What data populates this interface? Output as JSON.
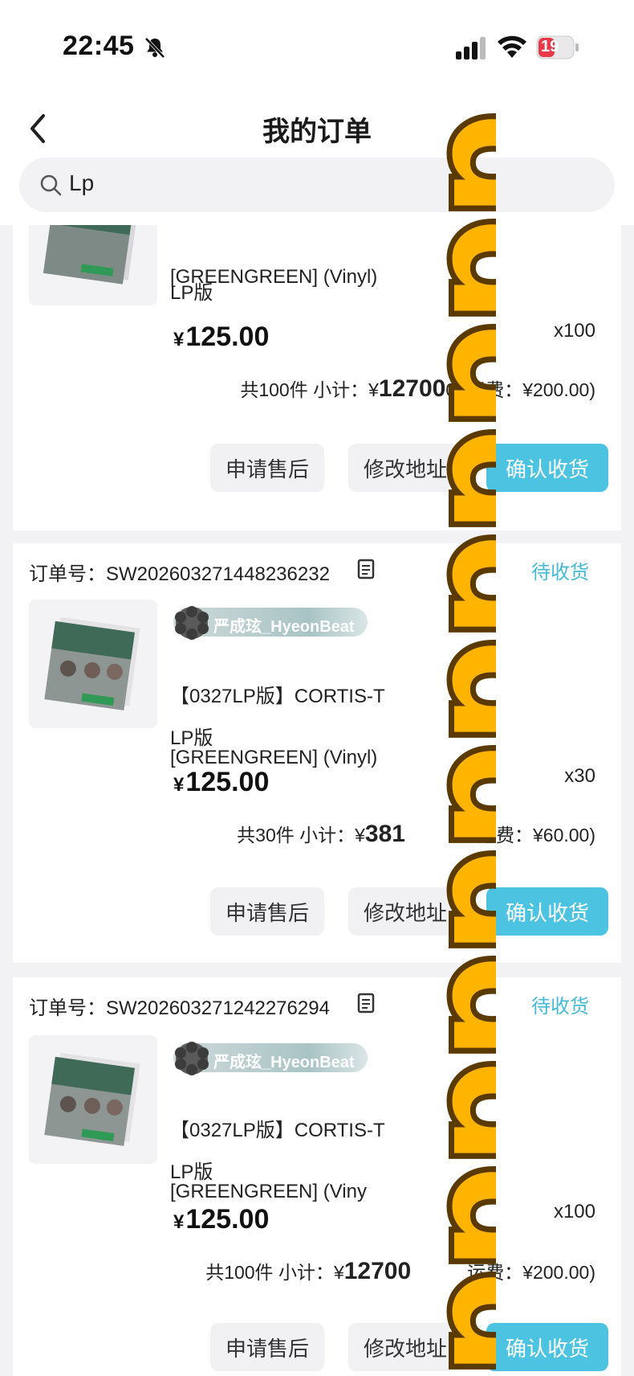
{
  "status_bar": {
    "time": "22:45",
    "battery": "19"
  },
  "header": {
    "title": "我的订单",
    "search_value": "Lp"
  },
  "orders": [
    {
      "order_no": "",
      "status": "",
      "shop": "",
      "title_line2": "[GREENGREEN] (Vinyl)",
      "variant": "LP版",
      "price": "125.00",
      "qty": "x100",
      "count_text": "共100件 小计：¥",
      "subtotal_big": "12700",
      "subtotal_tail": "0 (",
      "shipping": "运费：¥200.00)",
      "btn_after_sale": "申请售后",
      "btn_modify": "修改地址",
      "btn_confirm": "确认收货"
    },
    {
      "order_no": "订单号：SW202603271448236232",
      "status": "待收货",
      "shop": "严成玹_HyeonBeat",
      "title_line1": "【0327LP版】CORTIS-T",
      "title_line2": "[GREENGREEN] (Vinyl)",
      "variant": "LP版",
      "price": "125.00",
      "qty": "x30",
      "count_text": "共30件 小计：¥",
      "subtotal_big": "381",
      "shipping": "运费：¥60.00)",
      "btn_after_sale": "申请售后",
      "btn_modify": "修改地址",
      "btn_confirm": "确认收货"
    },
    {
      "order_no": "订单号：SW202603271242276294",
      "status": "待收货",
      "shop": "严成玹_HyeonBeat",
      "title_line1": "【0327LP版】CORTIS-T",
      "title_line2": "[GREENGREEN] (Viny",
      "variant": "LP版",
      "price": "125.00",
      "qty": "x100",
      "count_text": "共100件 小计：¥",
      "subtotal_big": "12700",
      "shipping": "运费：¥200.00)",
      "btn_after_sale": "申请售后",
      "btn_modify": "修改地址",
      "btn_confirm": "确认收货"
    }
  ],
  "overlay": {
    "sticker_text": "dddddddddddd",
    "fill_color": "#FFB400",
    "outline_color": "#5a3a00"
  },
  "colors": {
    "accent": "#4cc3e0",
    "status_text": "#46b9d6"
  }
}
